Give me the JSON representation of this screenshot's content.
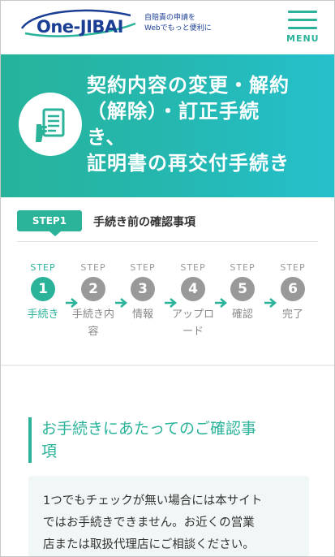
{
  "header": {
    "logo_text": "One-JIBAI",
    "tagline_line1": "自賠責の申請を",
    "tagline_line2": "Webでもっと便利に",
    "menu_label": "MENU"
  },
  "hero": {
    "title_lines": [
      "契約内容の変更・解約",
      "（解除）・訂正手続",
      "き、",
      "証明書の再交付手続き"
    ],
    "icon": "document-with-hand-icon"
  },
  "step_header": {
    "badge": "STEP1",
    "title": "手続き前の確認事項"
  },
  "steps": [
    {
      "label": "STEP",
      "number": "1",
      "name_lines": [
        "手続き"
      ],
      "active": true
    },
    {
      "label": "STEP",
      "number": "2",
      "name_lines": [
        "手続き内",
        "容"
      ],
      "active": false
    },
    {
      "label": "STEP",
      "number": "3",
      "name_lines": [
        "情報"
      ],
      "active": false
    },
    {
      "label": "STEP",
      "number": "4",
      "name_lines": [
        "アップロ",
        "ード"
      ],
      "active": false
    },
    {
      "label": "STEP",
      "number": "5",
      "name_lines": [
        "確認"
      ],
      "active": false
    },
    {
      "label": "STEP",
      "number": "6",
      "name_lines": [
        "完了"
      ],
      "active": false
    }
  ],
  "section": {
    "heading_lines": [
      "お手続きにあたってのご確認事",
      "項"
    ]
  },
  "notice": {
    "lines": [
      "1つでもチェックが無い場合には本サイト",
      "ではお手続きできません。お近くの営業",
      "店または取扱代理店にご相談ください。"
    ]
  },
  "colors": {
    "accent": "#2bb39a",
    "brand": "#1b3e95",
    "inactive": "#999999"
  }
}
